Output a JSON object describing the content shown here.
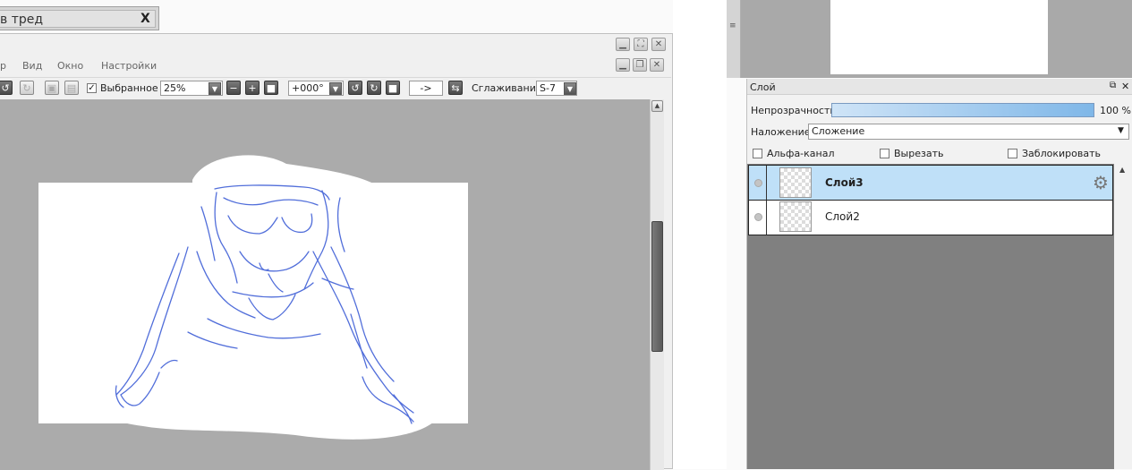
{
  "thread_tab": {
    "title": "в тред",
    "close_label": "X"
  },
  "canvas_window": {
    "menu": [
      "р",
      "Вид",
      "Окно",
      "Настройки"
    ],
    "toolbar": {
      "selected_label": "Выбранное",
      "zoom": "25%",
      "rotation": "+000°",
      "arrow_label": "->",
      "smoothing_label": "Сглаживание",
      "smoothing_value": "S-7"
    },
    "scrollbar_position": 0.55
  },
  "layer_panel": {
    "title": "Слой",
    "opacity_label": "Непрозрачность",
    "opacity_value": "100 %",
    "opacity_fraction": 1.0,
    "blend_label": "Наложение",
    "blend_value": "Сложение",
    "checkboxes": [
      {
        "label": "Альфа-канал",
        "checked": false
      },
      {
        "label": "Вырезать",
        "checked": false
      },
      {
        "label": "Заблокировать",
        "checked": false
      }
    ],
    "layers": [
      {
        "name": "Слой3",
        "selected": true
      },
      {
        "name": "Слой2",
        "selected": false
      }
    ]
  },
  "colors": {
    "selected_row": "#bfe0f8",
    "sketch_stroke": "#3f5fd6",
    "canvas_bg": "#ababab"
  }
}
